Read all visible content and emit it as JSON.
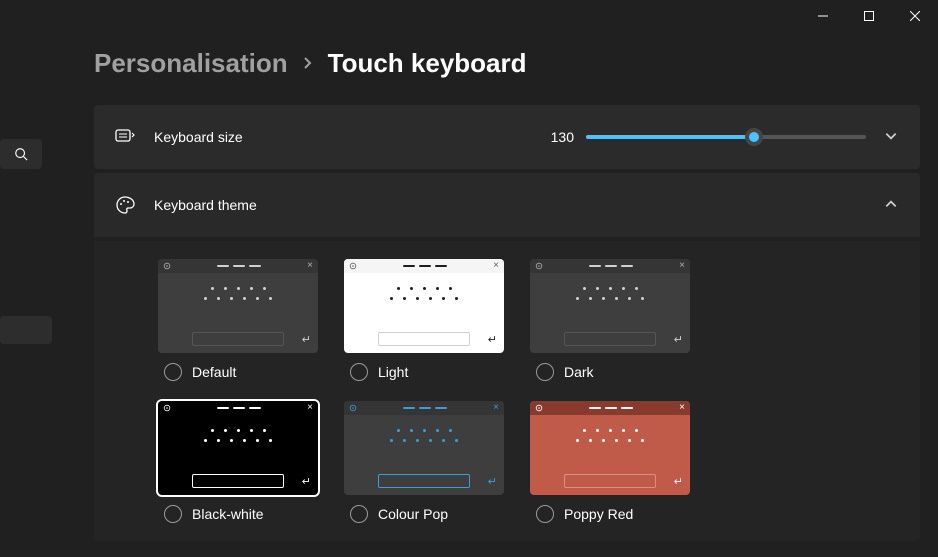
{
  "breadcrumb": {
    "parent": "Personalisation",
    "current": "Touch keyboard"
  },
  "keyboard_size": {
    "label": "Keyboard size",
    "value": "130",
    "percent": 60
  },
  "keyboard_theme": {
    "label": "Keyboard theme",
    "expanded": true
  },
  "themes": [
    {
      "id": "default",
      "label": "Default",
      "selected": false,
      "titlebar": "#353535",
      "body": "#3e3e3e",
      "dot": "#d0d0d0",
      "dash": "#d0d0d0",
      "accent": "#d0d0d0",
      "space_outline": "#555",
      "gear": "#b0b0b0",
      "close": "#b0b0b0"
    },
    {
      "id": "light",
      "label": "Light",
      "selected": false,
      "titlebar": "#f5f5f5",
      "body": "#ffffff",
      "dot": "#202020",
      "dash": "#202020",
      "accent": "#202020",
      "space_outline": "#d0d0d0",
      "gear": "#606060",
      "close": "#606060"
    },
    {
      "id": "dark",
      "label": "Dark",
      "selected": false,
      "titlebar": "#353535",
      "body": "#3e3e3e",
      "dot": "#d0d0d0",
      "dash": "#d0d0d0",
      "accent": "#d0d0d0",
      "space_outline": "#555",
      "gear": "#b0b0b0",
      "close": "#b0b0b0"
    },
    {
      "id": "blackwhite",
      "label": "Black-white",
      "selected": true,
      "titlebar": "#000000",
      "body": "#000000",
      "dot": "#ffffff",
      "dash": "#ffffff",
      "accent": "#ffffff",
      "space_outline": "#ffffff",
      "gear": "#ffffff",
      "close": "#ffffff"
    },
    {
      "id": "colourpop",
      "label": "Colour Pop",
      "selected": false,
      "titlebar": "#353535",
      "body": "#3e3e3e",
      "dot": "#3b9dd6",
      "dash": "#3b9dd6",
      "accent": "#3b9dd6",
      "space_outline": "#3b9dd6",
      "gear": "#3b9dd6",
      "close": "#3b9dd6"
    },
    {
      "id": "poppyred",
      "label": "Poppy Red",
      "selected": false,
      "titlebar": "#8a3a2d",
      "body": "#c05b4a",
      "dot": "#ffffff",
      "dash": "#ffffff",
      "accent": "#ffffff",
      "space_outline": "#d89085",
      "gear": "#ffffff",
      "close": "#ffffff"
    }
  ]
}
